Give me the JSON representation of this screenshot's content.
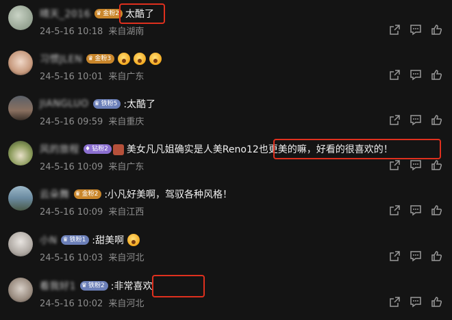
{
  "comments": [
    {
      "username": "晴天_2016",
      "badge": "金粉2",
      "text": "太酷了",
      "date": "24-5-16 10:18",
      "location": "来自湖南"
    },
    {
      "username": "习惯JLEN",
      "badge": "金粉3",
      "text": "",
      "date": "24-5-16 10:01",
      "location": "来自广东"
    },
    {
      "username": "JIANGLUO",
      "badge": "铁粉5",
      "text": ":太酷了",
      "date": "24-5-16 09:59",
      "location": "来自重庆"
    },
    {
      "username": "风的旅程",
      "badge": "钻粉2",
      "text": "美女凡凡姐确实是人美Reno12也更美的嘛，好看的很喜欢的！",
      "date": "24-5-16 10:09",
      "location": "来自广东"
    },
    {
      "username": "云朵舞",
      "badge": "金粉2",
      "text": ":小凡好美啊，驾驭各种风格！",
      "date": "24-5-16 10:09",
      "location": "来自江西"
    },
    {
      "username": "小N",
      "badge": "铁粉1",
      "text": ":甜美啊",
      "date": "24-5-16 10:03",
      "location": "来自河北"
    },
    {
      "username": "看我好1",
      "badge": "铁粉2",
      "text": ":非常喜欢",
      "date": "24-5-16 10:02",
      "location": "来自河北"
    }
  ]
}
